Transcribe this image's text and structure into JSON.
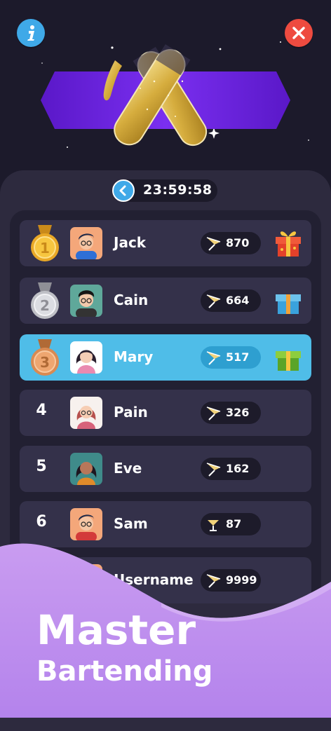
{
  "header": {
    "info_icon": "info-icon",
    "close_icon": "close-icon",
    "colors": {
      "info": "#3fa9e8",
      "close": "#ee4b40",
      "banner": "#6a1fd8",
      "gold": "#d8b24a"
    }
  },
  "timer": {
    "icon": "clock-icon",
    "value": "23:59:58"
  },
  "leaderboard": {
    "rows": [
      {
        "rank": "1",
        "medal": "gold-medal-icon",
        "name": "Jack",
        "score": "870",
        "gift": "red-gift-icon",
        "highlighted": false
      },
      {
        "rank": "2",
        "medal": "silver-medal-icon",
        "name": "Cain",
        "score": "664",
        "gift": "blue-gift-icon",
        "highlighted": false
      },
      {
        "rank": "3",
        "medal": "bronze-medal-icon",
        "name": "Mary",
        "score": "517",
        "gift": "green-gift-icon",
        "highlighted": true
      },
      {
        "rank": "4",
        "name": "Pain",
        "score": "326"
      },
      {
        "rank": "5",
        "name": "Eve",
        "score": "162"
      },
      {
        "rank": "6",
        "name": "Sam",
        "score": "87"
      },
      {
        "rank": "",
        "name": "Username",
        "score": "9999"
      }
    ]
  },
  "promo": {
    "line1": "Master",
    "line2": "Bartending"
  }
}
